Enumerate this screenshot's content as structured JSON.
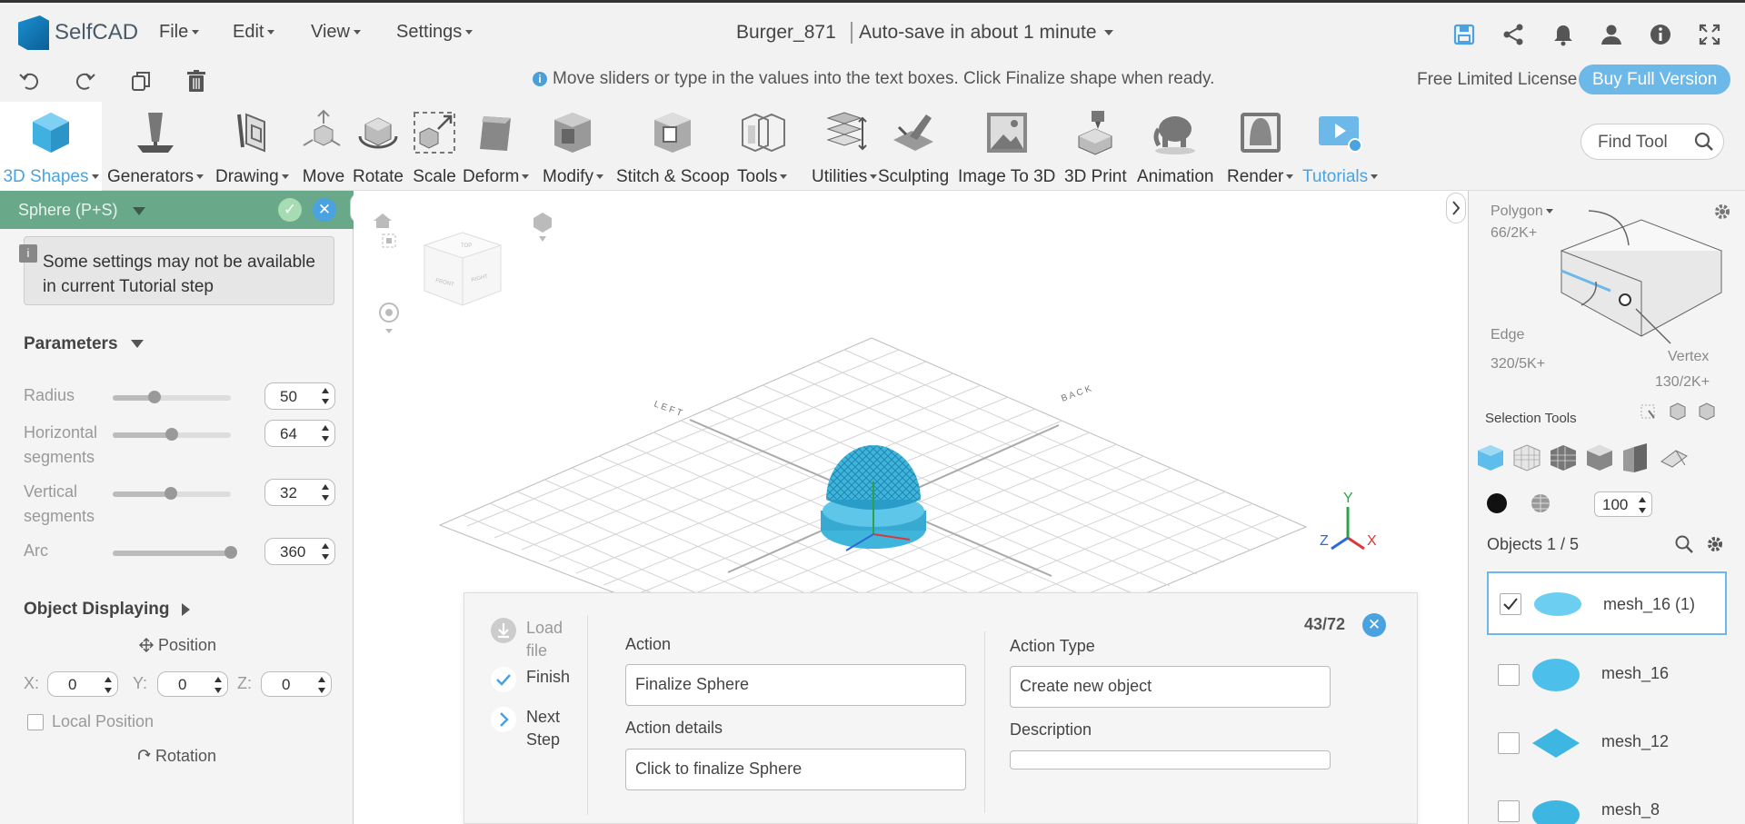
{
  "app": {
    "name": "SelfCAD",
    "doc_name": "Burger_871",
    "autosave": "Auto-save in about 1 minute"
  },
  "menu": {
    "file": "File",
    "edit": "Edit",
    "view": "View",
    "settings": "Settings"
  },
  "hint": "Move sliders or type in the values into the text boxes. Click Finalize shape when ready.",
  "license": {
    "label": "Free Limited License",
    "buy": "Buy Full Version"
  },
  "tools": [
    {
      "label": "3D Shapes"
    },
    {
      "label": "Generators"
    },
    {
      "label": "Drawing"
    },
    {
      "label": "Move"
    },
    {
      "label": "Rotate"
    },
    {
      "label": "Scale"
    },
    {
      "label": "Deform"
    },
    {
      "label": "Modify"
    },
    {
      "label": "Stitch & Scoop"
    },
    {
      "label": "Tools"
    },
    {
      "label": "Utilities"
    },
    {
      "label": "Sculpting"
    },
    {
      "label": "Image To 3D"
    },
    {
      "label": "3D Print"
    },
    {
      "label": "Animation"
    },
    {
      "label": "Render"
    },
    {
      "label": "Tutorials"
    }
  ],
  "find_tool": "Find Tool",
  "left_panel": {
    "title": "Sphere (P+S)",
    "notice": "Some settings may not be available in current Tutorial step",
    "parameters": "Parameters",
    "params": [
      {
        "label": "Radius",
        "value": "50",
        "fraction": 0.35
      },
      {
        "label": "Horizontal segments",
        "value": "64",
        "fraction": 0.5
      },
      {
        "label": "Vertical segments",
        "value": "32",
        "fraction": 0.49
      },
      {
        "label": "Arc",
        "value": "360",
        "fraction": 1.0
      }
    ],
    "object_displaying": "Object Displaying",
    "position": "Position",
    "pos": {
      "x_label": "X:",
      "x": "0",
      "y_label": "Y:",
      "y": "0",
      "z_label": "Z:",
      "z": "0"
    },
    "local_position": "Local Position",
    "rotation": "Rotation"
  },
  "tutorial": {
    "load_file": "Load file",
    "finish": "Finish",
    "next_step": "Next Step",
    "counter": "43/72",
    "action_label": "Action",
    "action_value": "Finalize Sphere",
    "action_details_label": "Action details",
    "action_details_value": "Click to finalize Sphere",
    "action_type_label": "Action Type",
    "action_type_value": "Create new object",
    "description_label": "Description",
    "description_value": ""
  },
  "right_panel": {
    "polygon_label": "Polygon",
    "polygon_count": "66/2K+",
    "edge_label": "Edge",
    "edge_count": "320/5K+",
    "vertex_label": "Vertex",
    "vertex_count": "130/2K+",
    "selection_tools": "Selection Tools",
    "opacity": "100",
    "objects_header": "Objects 1 / 5",
    "objects": [
      {
        "name": "mesh_16 (1)",
        "checked": true
      },
      {
        "name": "mesh_16",
        "checked": false
      },
      {
        "name": "mesh_12",
        "checked": false
      },
      {
        "name": "mesh_8",
        "checked": false
      }
    ]
  },
  "axis": {
    "x": "X",
    "y": "Y",
    "z": "Z"
  },
  "colors": {
    "accent": "#4aa3e0",
    "panel_head": "#6aa88a",
    "mesh": "#3fb5dc"
  }
}
